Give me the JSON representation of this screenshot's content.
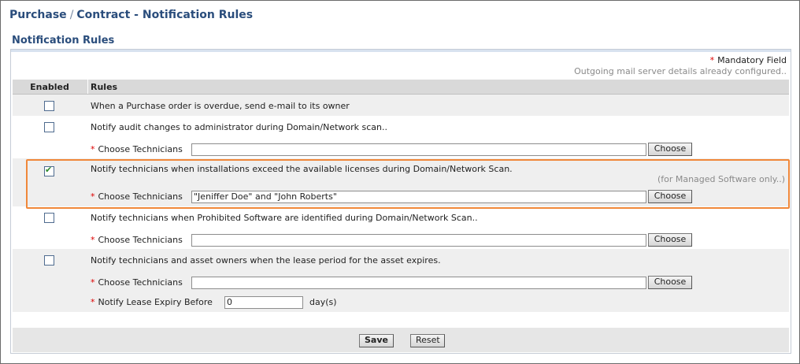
{
  "breadcrumb": {
    "part1": "Purchase",
    "separator": "/",
    "part2": "Contract - Notification Rules"
  },
  "section_title": "Notification Rules",
  "mandatory": {
    "star": "*",
    "label": "Mandatory Field"
  },
  "mail_note": "Outgoing mail server details already configured..",
  "columns": {
    "enabled": "Enabled",
    "rules": "Rules"
  },
  "rules": [
    {
      "text": "When a Purchase order is overdue, send e-mail to its owner",
      "enabled": false
    },
    {
      "text": "Notify audit changes to administrator during Domain/Network scan..",
      "enabled": false,
      "field_label": "Choose Technicians",
      "field_value": "",
      "button": "Choose"
    },
    {
      "text": "Notify technicians when installations exceed the available licenses during Domain/Network Scan.",
      "enabled": true,
      "note": "(for Managed Software only..)",
      "field_label": "Choose Technicians",
      "field_value": "\"Jeniffer Doe\" and \"John Roberts\"",
      "button": "Choose"
    },
    {
      "text": "Notify technicians when Prohibited Software are identified during Domain/Network Scan..",
      "enabled": false,
      "field_label": "Choose Technicians",
      "field_value": "",
      "button": "Choose"
    },
    {
      "text": "Notify technicians and asset owners when the lease period for the asset expires.",
      "enabled": false,
      "field_label": "Choose Technicians",
      "field_value": "",
      "button": "Choose",
      "expiry_label": "Notify Lease Expiry Before",
      "expiry_value": "0",
      "expiry_unit": "day(s)"
    }
  ],
  "required_star": "*",
  "buttons": {
    "save": "Save",
    "reset": "Reset"
  },
  "colors": {
    "accent": "#2a4d7c",
    "highlight": "#f0883a",
    "required": "#dd0000"
  }
}
